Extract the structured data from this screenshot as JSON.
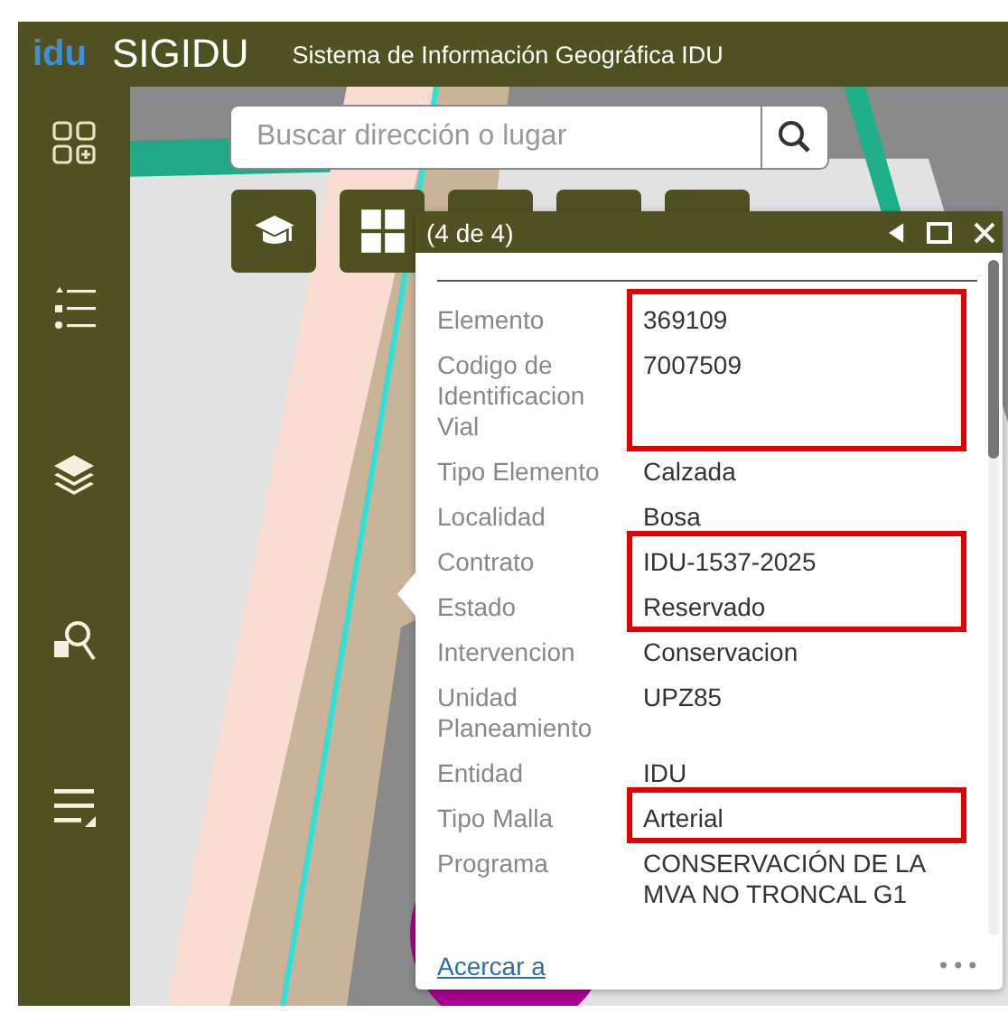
{
  "header": {
    "logo": "idu",
    "app_name": "SIGIDU",
    "subtitle": "Sistema de Información Geográfica IDU"
  },
  "search": {
    "placeholder": "Buscar dirección o lugar"
  },
  "popup": {
    "counter": "(4 de 4)",
    "field_groups": [
      {
        "highlighted": true,
        "fields": [
          {
            "label": "Elemento",
            "value": "369109"
          },
          {
            "label": "Codigo de Identificacion Vial",
            "value": "7007509"
          }
        ]
      },
      {
        "highlighted": false,
        "fields": [
          {
            "label": "Tipo Elemento",
            "value": "Calzada"
          },
          {
            "label": "Localidad",
            "value": "Bosa"
          }
        ]
      },
      {
        "highlighted": true,
        "fields": [
          {
            "label": "Contrato",
            "value": "IDU-1537-2025"
          },
          {
            "label": "Estado",
            "value": "Reservado"
          }
        ]
      },
      {
        "highlighted": false,
        "fields": [
          {
            "label": "Intervencion",
            "value": "Conservacion"
          },
          {
            "label": "Unidad Planeamiento",
            "value": "UPZ85"
          },
          {
            "label": "Entidad",
            "value": "IDU"
          }
        ]
      },
      {
        "highlighted": true,
        "fields": [
          {
            "label": "Tipo Malla",
            "value": "Arterial"
          }
        ]
      },
      {
        "highlighted": false,
        "fields": [
          {
            "label": "Programa",
            "value": "CONSERVACIÓN DE LA MVA NO TRONCAL G1"
          }
        ]
      }
    ],
    "zoom_link": "Acercar a",
    "more": "•••"
  }
}
